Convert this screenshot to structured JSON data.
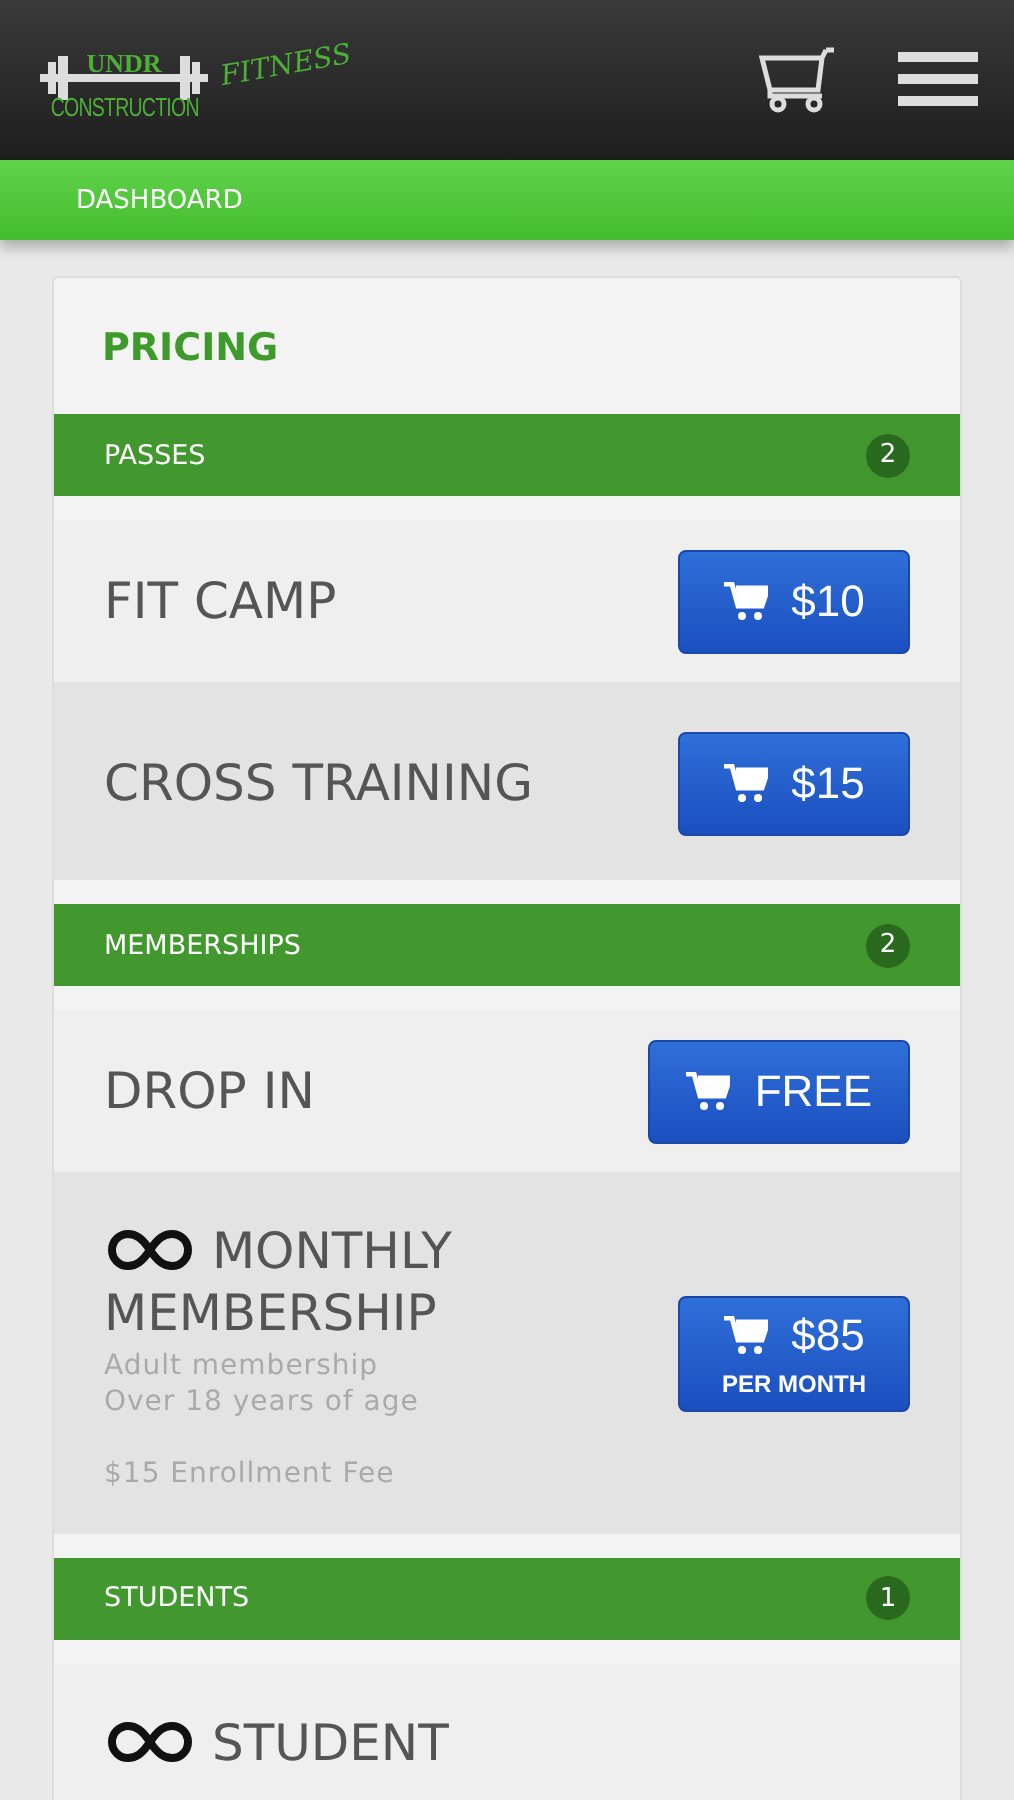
{
  "header": {
    "logo": {
      "top": "UNDR",
      "bottom": "CONSTRUCTION",
      "script": "FITNESS"
    }
  },
  "breadcrumb": "DASHBOARD",
  "pricing": {
    "title": "PRICING",
    "sections": [
      {
        "name": "PASSES",
        "count": "2",
        "items": [
          {
            "title": "FIT CAMP",
            "recurring": false,
            "price": "$10"
          },
          {
            "title": "CROSS TRAINING",
            "recurring": false,
            "price": "$15"
          }
        ]
      },
      {
        "name": "MEMBERSHIPS",
        "count": "2",
        "items": [
          {
            "title": "DROP IN",
            "recurring": false,
            "price": "FREE"
          },
          {
            "title": "MONTHLY MEMBERSHIP",
            "recurring": true,
            "price": "$85",
            "period": "PER MONTH",
            "details": [
              "Adult membership",
              "Over 18 years of age"
            ],
            "fee": "$15 Enrollment Fee"
          }
        ]
      },
      {
        "name": "STUDENTS",
        "count": "1",
        "items": [
          {
            "title": "STUDENT",
            "recurring": true
          }
        ]
      }
    ]
  }
}
